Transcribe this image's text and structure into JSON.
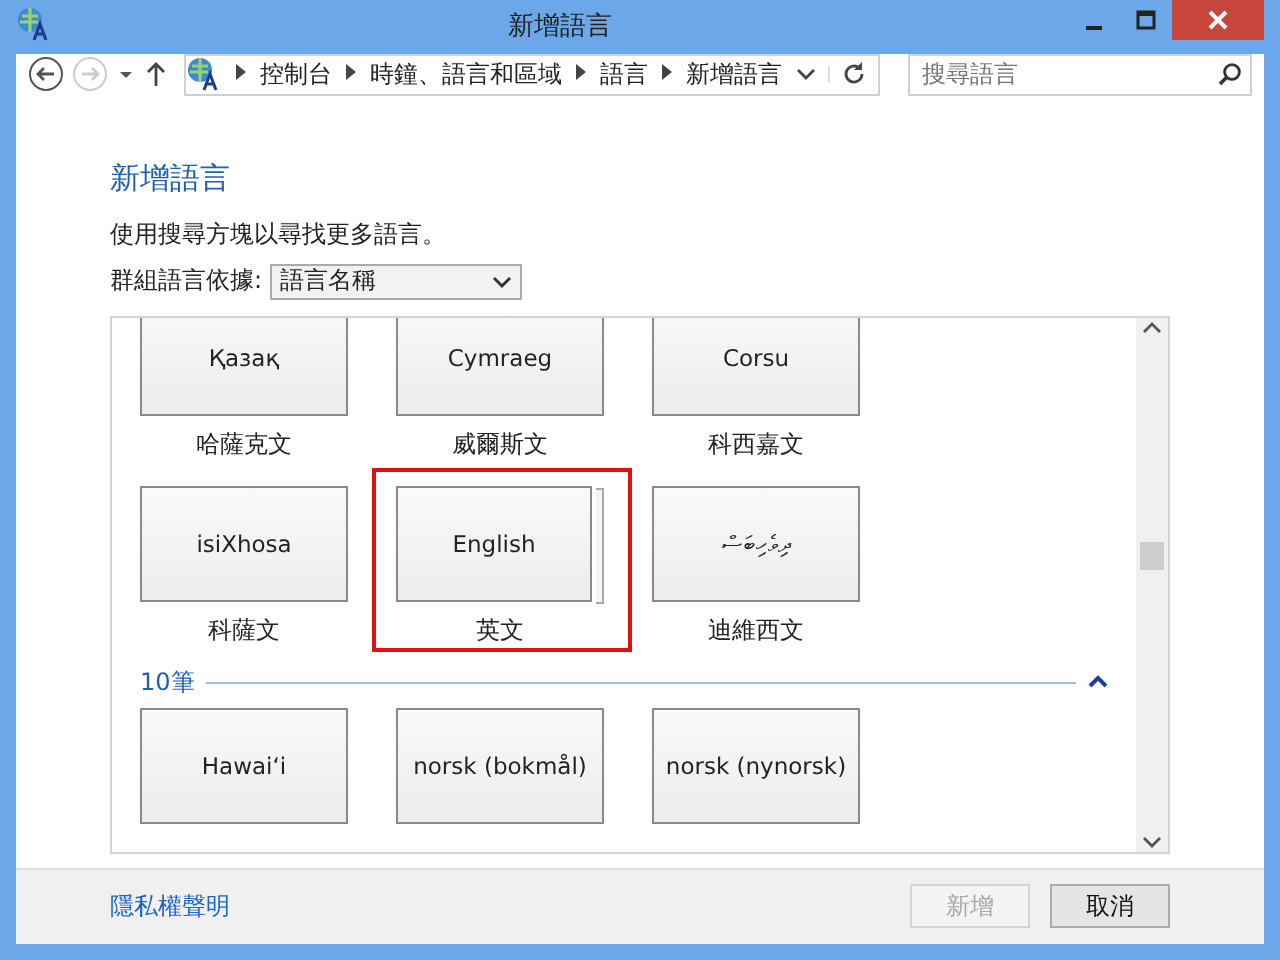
{
  "window": {
    "title": "新增語言"
  },
  "address_bar": {
    "breadcrumbs": [
      "控制台",
      "時鐘、語言和區域",
      "語言",
      "新增語言"
    ]
  },
  "search": {
    "placeholder": "搜尋語言"
  },
  "page": {
    "heading": "新增語言",
    "instruction": "使用搜尋方塊以尋找更多語言。",
    "group_label": "群組語言依據:",
    "group_by": "語言名稱"
  },
  "sections": [
    {
      "rows": [
        [
          {
            "name": "Қазақ",
            "label": "哈薩克文",
            "kind": "single",
            "highlighted": false
          },
          {
            "name": "Cymraeg",
            "label": "威爾斯文",
            "kind": "single",
            "highlighted": false
          },
          {
            "name": "Corsu",
            "label": "科西嘉文",
            "kind": "single",
            "highlighted": false
          }
        ],
        [
          {
            "name": "isiXhosa",
            "label": "科薩文",
            "kind": "single",
            "highlighted": false
          },
          {
            "name": "English",
            "label": "英文",
            "kind": "stacked",
            "highlighted": true
          },
          {
            "name": "ދިވެހިބަސް",
            "label": "迪維西文",
            "kind": "single",
            "highlighted": false
          }
        ]
      ]
    },
    {
      "header": "10筆",
      "expanded": true,
      "rows": [
        [
          {
            "name": "Hawaiʻi",
            "kind": "single",
            "highlighted": false
          },
          {
            "name": "norsk (bokmål)",
            "kind": "single",
            "highlighted": false
          },
          {
            "name": "norsk (nynorsk)",
            "kind": "single",
            "highlighted": false
          }
        ]
      ]
    }
  ],
  "footer": {
    "link": "隱私權聲明",
    "buttons": [
      {
        "label": "新增",
        "disabled": true
      },
      {
        "label": "取消",
        "disabled": false
      }
    ]
  }
}
